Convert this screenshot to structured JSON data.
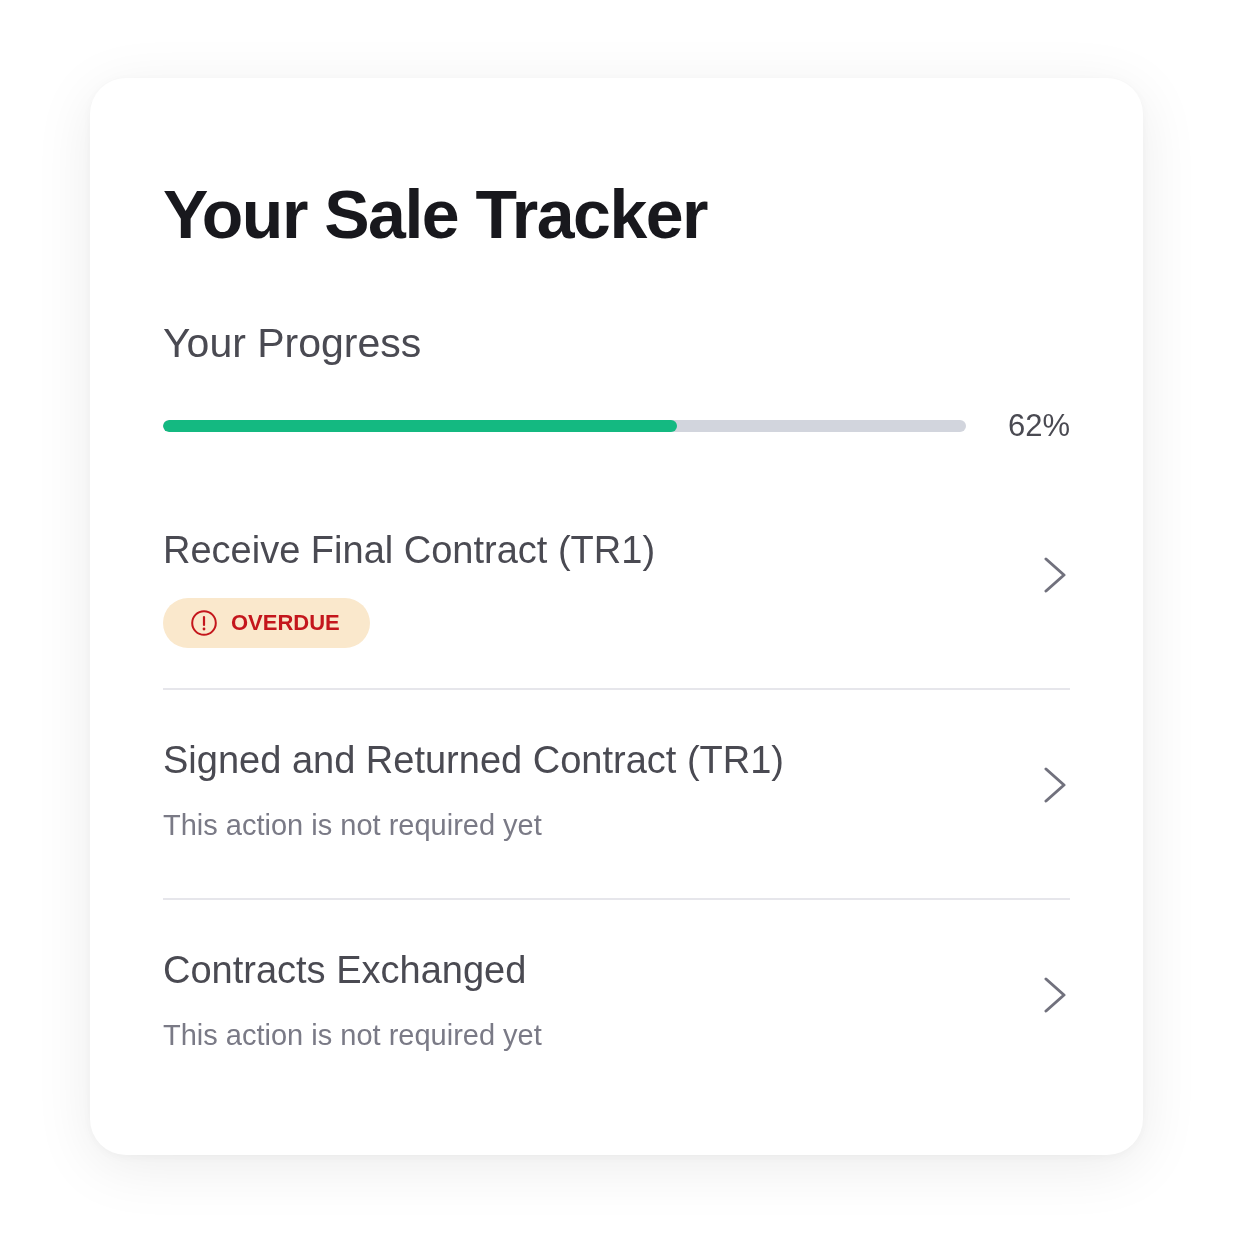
{
  "header": {
    "title": "Your Sale Tracker"
  },
  "progress": {
    "label": "Your Progress",
    "level": 0.64,
    "reading": "62%"
  },
  "steps": [
    {
      "kind": "badge",
      "title": "Receive Final Contract (TR1)",
      "badge": "OVERDUE"
    },
    {
      "kind": "note",
      "title": "Signed and Returned Contract (TR1)",
      "note": "This action is not required yet"
    },
    {
      "kind": "note",
      "title": "Contracts Exchanged",
      "note": "This action is not required yet"
    }
  ]
}
